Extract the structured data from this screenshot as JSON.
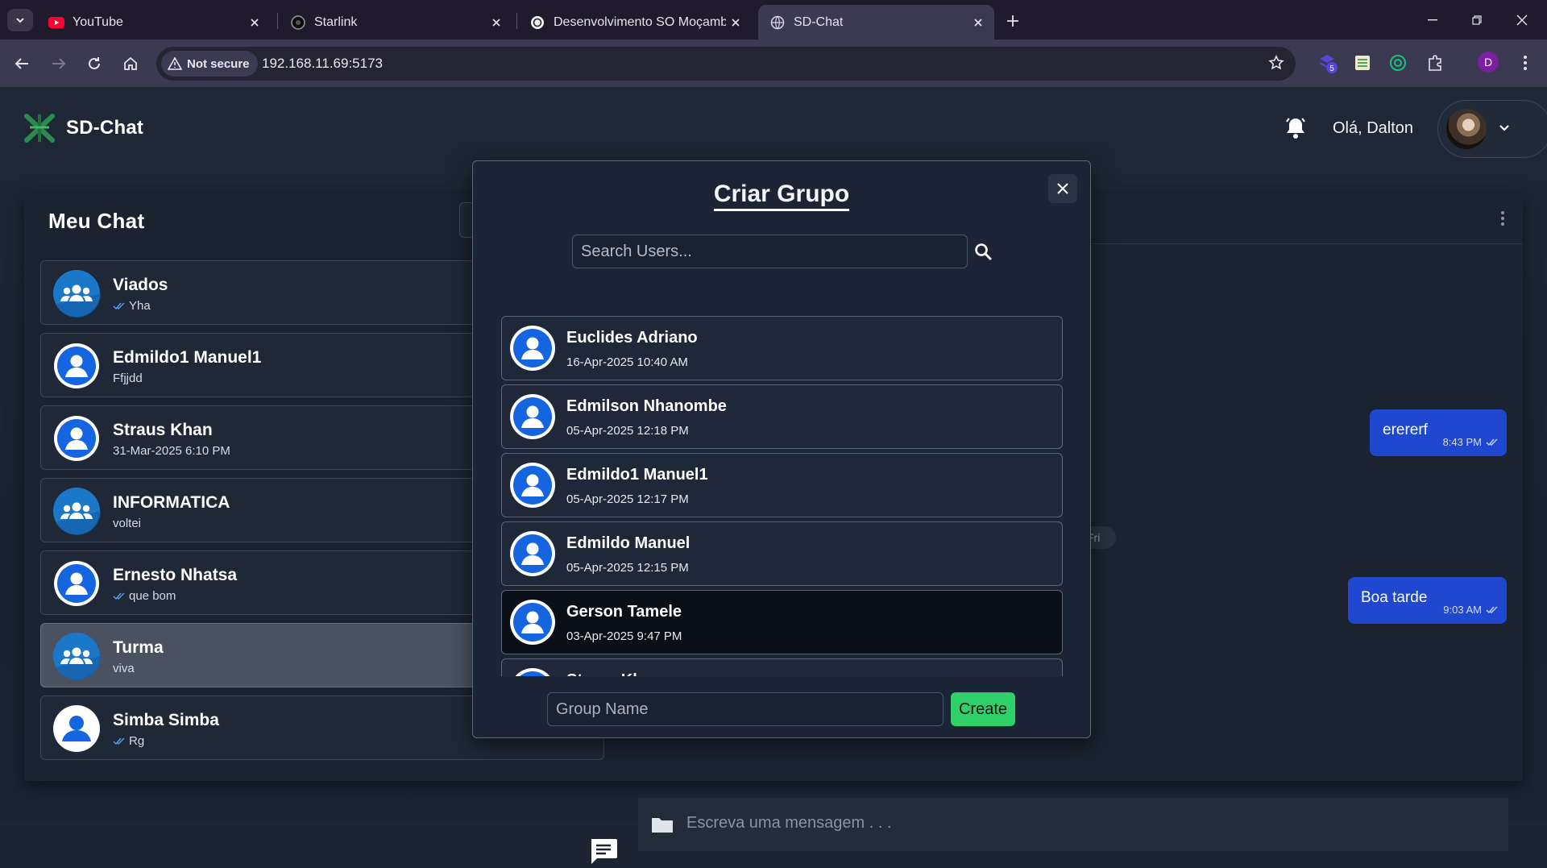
{
  "browser": {
    "tabs": [
      {
        "title": "YouTube",
        "icon": "youtube-icon"
      },
      {
        "title": "Starlink",
        "icon": "starlink-icon"
      },
      {
        "title": "Desenvolvimento SO Moçambique",
        "icon": "openai-icon"
      },
      {
        "title": "SD-Chat",
        "icon": "globe-icon"
      }
    ],
    "security_label": "Not secure",
    "url": "192.168.11.69:5173",
    "extension_badge": "5",
    "profile_initial": "D"
  },
  "app": {
    "name": "SD-Chat",
    "greeting": "Olá, Dalton",
    "chat_panel_title": "Meu Chat",
    "chats": [
      {
        "name": "Viados",
        "preview": "Yha",
        "kind": "group",
        "read": true
      },
      {
        "name": "Edmildo1 Manuel1",
        "preview": "Ffjjdd",
        "kind": "user",
        "read": false
      },
      {
        "name": "Straus Khan",
        "preview": "31-Mar-2025 6:10 PM",
        "kind": "user",
        "read": false
      },
      {
        "name": "INFORMATICA",
        "preview": "voltei",
        "kind": "group",
        "read": false
      },
      {
        "name": "Ernesto Nhatsa",
        "preview": "que bom",
        "kind": "user",
        "read": true
      },
      {
        "name": "Turma",
        "preview": "viva",
        "kind": "group",
        "read": false,
        "active": true
      },
      {
        "name": "Simba Simba",
        "preview": "Rg",
        "kind": "user",
        "read": true
      }
    ],
    "messages": [
      {
        "text": "erererf",
        "time": "8:43 PM"
      },
      {
        "text": "Boa tarde",
        "time": "9:03 AM"
      }
    ],
    "day_separator": "Fri",
    "composer_placeholder": "Escreva uma mensagem . . ."
  },
  "modal": {
    "title": "Criar Grupo",
    "search_placeholder": "Search Users...",
    "users": [
      {
        "name": "Euclides Adriano",
        "date": "16-Apr-2025 10:40 AM"
      },
      {
        "name": "Edmilson Nhanombe",
        "date": "05-Apr-2025 12:18 PM"
      },
      {
        "name": "Edmildo1 Manuel1",
        "date": "05-Apr-2025 12:17 PM"
      },
      {
        "name": "Edmildo Manuel",
        "date": "05-Apr-2025 12:15 PM"
      },
      {
        "name": "Gerson Tamele",
        "date": "03-Apr-2025 9:47 PM",
        "highlighted": true
      },
      {
        "name": "Straus Khan",
        "date": ""
      }
    ],
    "group_name_placeholder": "Group Name",
    "create_label": "Create"
  },
  "colors": {
    "accent_blue": "#1f47d0",
    "create_green": "#2fd06a",
    "avatar_blue": "#1565e0"
  }
}
